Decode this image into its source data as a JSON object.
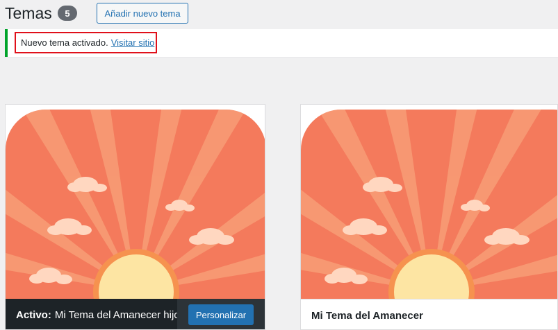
{
  "header": {
    "title": "Temas",
    "count": "5",
    "add_button_label": "Añadir nuevo tema"
  },
  "notice": {
    "message": "Nuevo tema activado.",
    "link_label": "Visitar sitio",
    "border_color": "#00a32a",
    "highlight_color": "#e0101a"
  },
  "themes": [
    {
      "active_prefix": "Activo:",
      "name": "Mi Tema del Amanecer hijo",
      "customize_label": "Personalizar"
    },
    {
      "name": "Mi Tema del Amanecer"
    }
  ],
  "colors": {
    "accent": "#2271b1",
    "sky": "#f47a5c",
    "sun": "#fde5a3"
  }
}
